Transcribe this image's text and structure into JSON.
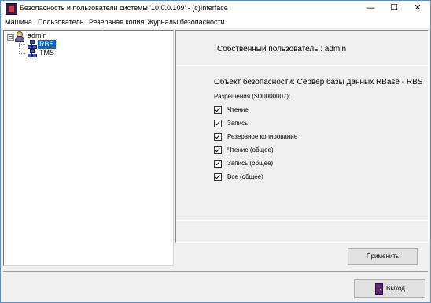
{
  "window": {
    "title": "Безопасность и пользователи системы '10.0.0.109' - (c)Interface",
    "controls": {
      "minimize": "—",
      "maximize": "☐",
      "close": "✕"
    }
  },
  "menu": [
    "Машина",
    "Пользователь",
    "Резервная копия",
    "Журналы безопасности"
  ],
  "tree": {
    "expander": "⊟",
    "root": {
      "label": "admin",
      "icon": "user-icon"
    },
    "children": [
      {
        "label": "RBS",
        "icon": "database-node-icon",
        "selected": true
      },
      {
        "label": "TMS",
        "icon": "database-node-icon",
        "selected": false
      }
    ]
  },
  "detail": {
    "owner": "Собственный пользователь :  admin",
    "security_object": "Объект безопасности: Сервер базы данных RBase  -  RBS",
    "permissions_title": "Разрешения ($D0000007):",
    "permissions": [
      {
        "label": "Чтение",
        "checked": true
      },
      {
        "label": "Запись",
        "checked": true
      },
      {
        "label": "Резервное копирование",
        "checked": true
      },
      {
        "label": "Чтение (общее)",
        "checked": true
      },
      {
        "label": "Запись (общее)",
        "checked": true
      },
      {
        "label": "Все (общее)",
        "checked": true
      }
    ]
  },
  "buttons": {
    "apply": "Применить",
    "exit": "Выход"
  }
}
